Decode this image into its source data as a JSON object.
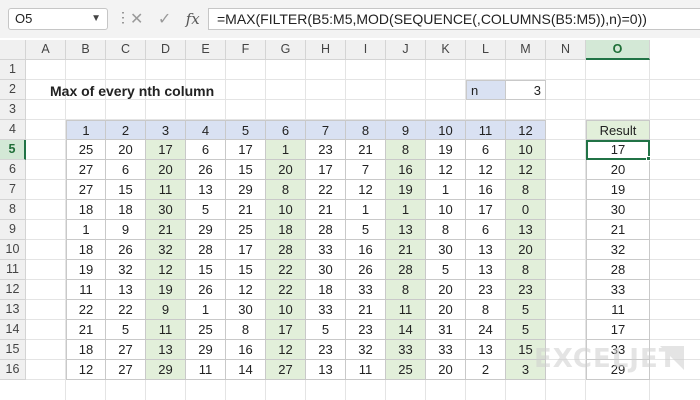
{
  "formula_bar": {
    "cell_ref": "O5",
    "cancel_icon": "✕",
    "confirm_icon": "✓",
    "fx_label": "fx",
    "formula": "=MAX(FILTER(B5:M5,MOD(SEQUENCE(,COLUMNS(B5:M5)),n)=0))"
  },
  "columns": [
    "A",
    "B",
    "C",
    "D",
    "E",
    "F",
    "G",
    "H",
    "I",
    "J",
    "K",
    "L",
    "M",
    "N",
    "O"
  ],
  "rows": [
    "1",
    "2",
    "3",
    "4",
    "5",
    "6",
    "7",
    "8",
    "9",
    "10",
    "11",
    "12",
    "13",
    "14",
    "15",
    "16"
  ],
  "active_column": "O",
  "active_row": "5",
  "sheet": {
    "title": "Max of every nth column",
    "n_label": "n",
    "n_value": "3",
    "headers": [
      "1",
      "2",
      "3",
      "4",
      "5",
      "6",
      "7",
      "8",
      "9",
      "10",
      "11",
      "12"
    ],
    "highlighted_columns": [
      3,
      6,
      9,
      12
    ],
    "data": [
      [
        "25",
        "20",
        "17",
        "6",
        "17",
        "1",
        "23",
        "21",
        "8",
        "19",
        "6",
        "10"
      ],
      [
        "27",
        "6",
        "20",
        "26",
        "15",
        "20",
        "17",
        "7",
        "16",
        "12",
        "12",
        "12"
      ],
      [
        "27",
        "15",
        "11",
        "13",
        "29",
        "8",
        "22",
        "12",
        "19",
        "1",
        "16",
        "8"
      ],
      [
        "18",
        "18",
        "30",
        "5",
        "21",
        "10",
        "21",
        "1",
        "1",
        "10",
        "17",
        "0"
      ],
      [
        "1",
        "9",
        "21",
        "29",
        "25",
        "18",
        "28",
        "5",
        "13",
        "8",
        "6",
        "13"
      ],
      [
        "18",
        "26",
        "32",
        "28",
        "17",
        "28",
        "33",
        "16",
        "21",
        "30",
        "13",
        "20"
      ],
      [
        "19",
        "32",
        "12",
        "15",
        "15",
        "22",
        "30",
        "26",
        "28",
        "5",
        "13",
        "8"
      ],
      [
        "11",
        "13",
        "19",
        "26",
        "12",
        "22",
        "18",
        "33",
        "8",
        "20",
        "23",
        "23"
      ],
      [
        "22",
        "22",
        "9",
        "1",
        "30",
        "10",
        "33",
        "21",
        "11",
        "20",
        "8",
        "5"
      ],
      [
        "21",
        "5",
        "11",
        "25",
        "8",
        "17",
        "5",
        "23",
        "14",
        "31",
        "24",
        "5"
      ],
      [
        "18",
        "27",
        "13",
        "29",
        "16",
        "12",
        "23",
        "32",
        "33",
        "33",
        "13",
        "15"
      ],
      [
        "12",
        "27",
        "29",
        "11",
        "14",
        "27",
        "13",
        "11",
        "25",
        "20",
        "2",
        "3"
      ]
    ],
    "result_header": "Result",
    "results": [
      "17",
      "20",
      "19",
      "30",
      "21",
      "32",
      "28",
      "33",
      "11",
      "17",
      "33",
      "29"
    ]
  },
  "watermark": "EXCELJET",
  "colors": {
    "header_fill": "#d9e1f2",
    "highlight_fill": "#e2efda",
    "selection": "#217346"
  }
}
